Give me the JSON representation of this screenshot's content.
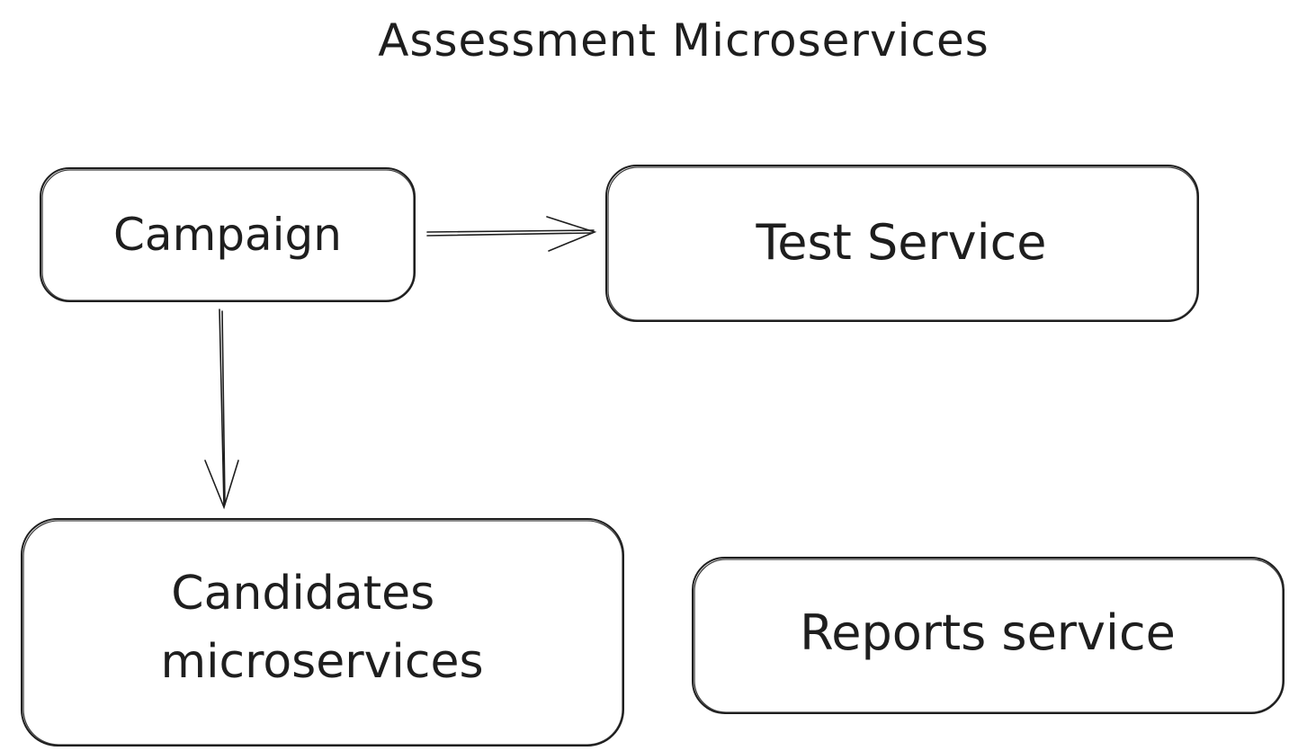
{
  "diagram": {
    "title": "Assessment Microservices",
    "nodes": {
      "campaign": {
        "label": [
          "Campaign"
        ]
      },
      "test_service": {
        "label": [
          "Test Service"
        ]
      },
      "candidates": {
        "label": [
          "Candidates",
          "microservices"
        ]
      },
      "reports": {
        "label": [
          "Reports service"
        ]
      }
    },
    "edges": [
      {
        "from": "campaign",
        "to": "test_service"
      },
      {
        "from": "campaign",
        "to": "candidates"
      }
    ],
    "colors": {
      "stroke": "#1e1e1e",
      "background": "#ffffff"
    }
  }
}
